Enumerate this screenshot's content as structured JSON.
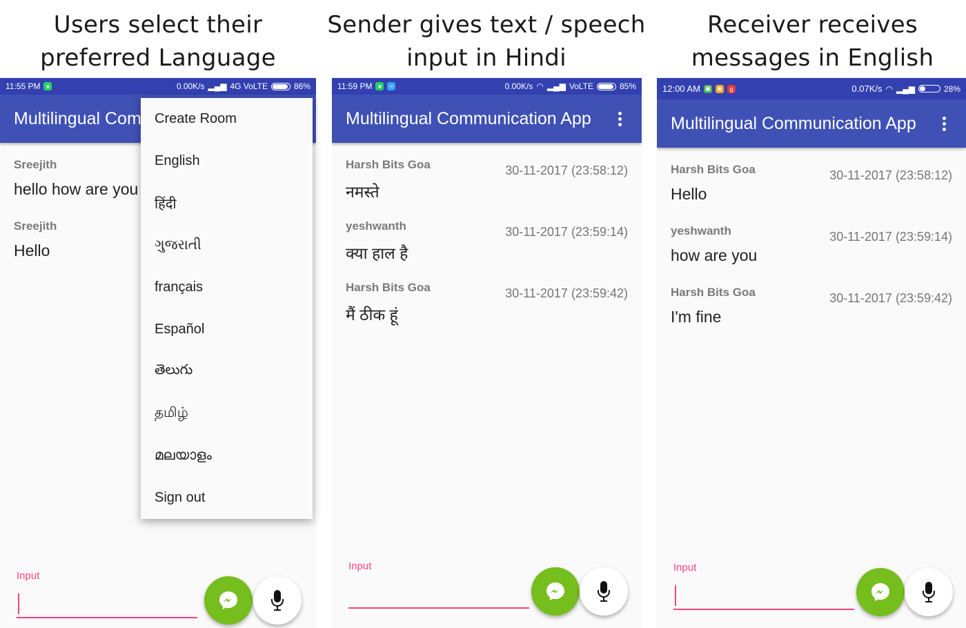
{
  "captions": [
    "Users select their preferred Language",
    "Sender gives text / speech input in Hindi",
    "Receiver receives messages in English"
  ],
  "colors": {
    "status_bar": "#3340b0",
    "app_bar": "#3f51b5",
    "accent_pink": "#ff4081",
    "send_green": "#76bd1e"
  },
  "panel1": {
    "status": {
      "time": "11:55 PM",
      "speed": "0.00K/s",
      "network": "4G VoLTE",
      "battery": "86%",
      "battery_level": 0.86
    },
    "title": "Multilingual Com",
    "messages": [
      {
        "sender": "Sreejith",
        "text": "hello how are you"
      },
      {
        "sender": "Sreejith",
        "text": "Hello"
      }
    ],
    "menu": [
      "Create Room",
      "English",
      "हिंदी",
      "ગુજરાતી",
      "français",
      "Español",
      "తెలుగు",
      "தமிழ்",
      "മലയാളം",
      "Sign out"
    ],
    "input_label": "Input"
  },
  "panel2": {
    "status": {
      "time": "11:59 PM",
      "speed": "0.00K/s",
      "network": "VoLTE",
      "battery": "85%",
      "battery_level": 0.85
    },
    "title": "Multilingual Communication App",
    "messages": [
      {
        "sender": "Harsh Bits Goa",
        "time": "30-11-2017 (23:58:12)",
        "text": "नमस्ते"
      },
      {
        "sender": "yeshwanth",
        "time": "30-11-2017 (23:59:14)",
        "text": "क्या हाल है"
      },
      {
        "sender": "Harsh Bits Goa",
        "time": "30-11-2017 (23:59:42)",
        "text": "मैं ठीक हूं"
      }
    ],
    "input_label": "Input"
  },
  "panel3": {
    "status": {
      "time": "12:00 AM",
      "speed": "0.07K/s",
      "battery": "28%",
      "battery_level": 0.28
    },
    "title": "Multilingual Communication App",
    "messages": [
      {
        "sender": "Harsh Bits Goa",
        "time": "30-11-2017 (23:58:12)",
        "text": "Hello"
      },
      {
        "sender": "yeshwanth",
        "time": "30-11-2017 (23:59:14)",
        "text": "how are you"
      },
      {
        "sender": "Harsh Bits Goa",
        "time": "30-11-2017 (23:59:42)",
        "text": "I'm fine"
      }
    ],
    "input_label": "Input"
  }
}
